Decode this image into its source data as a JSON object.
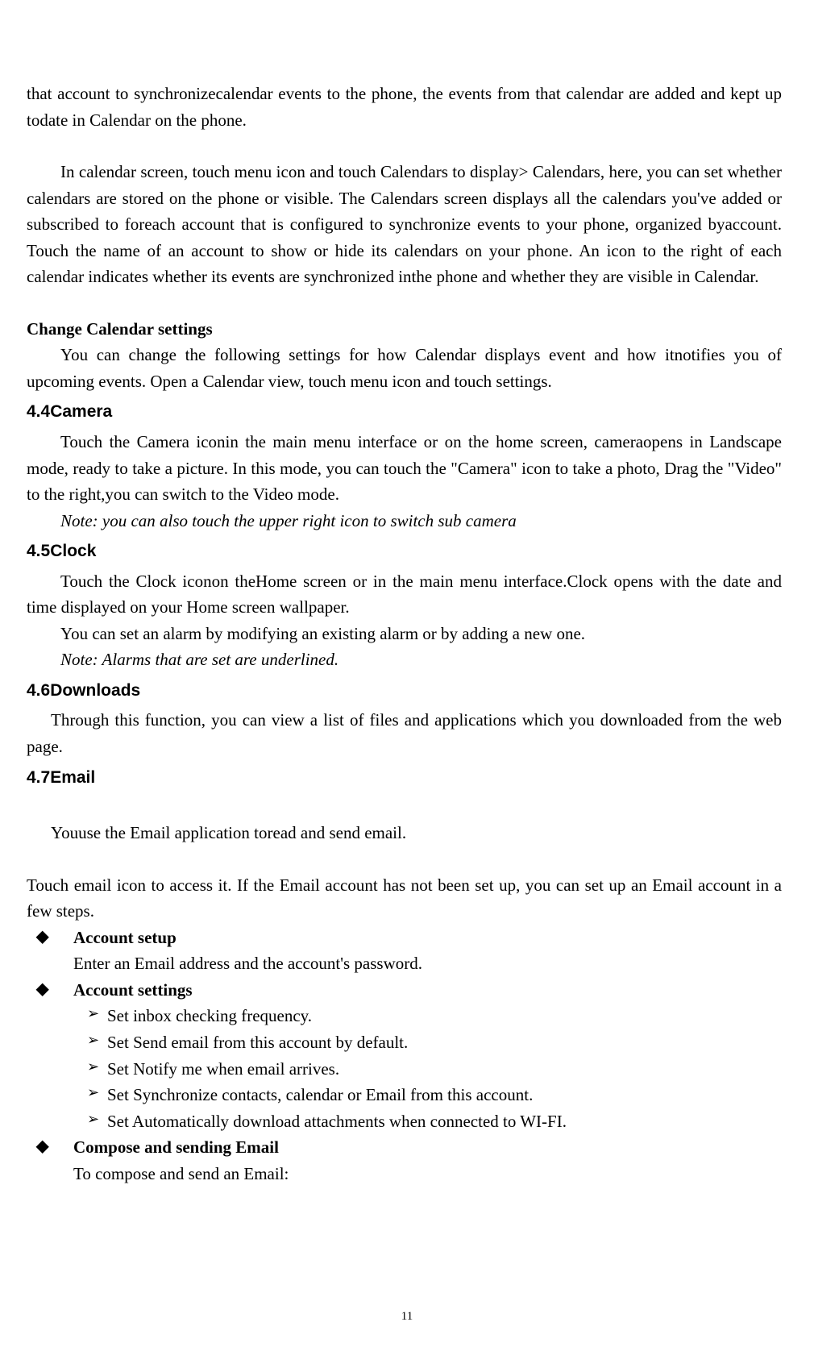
{
  "para1": "that account to synchronizecalendar events to the phone, the events from that calendar are added and kept up todate in Calendar on the phone.",
  "para2": "In calendar screen, touch menu icon and touch Calendars to display> Calendars, here, you can set whether calendars are stored on the phone or visible. The Calendars screen displays all the calendars you've added or subscribed to foreach account that is configured to synchronize events to your phone, organized byaccount. Touch the name of an account to show or hide its calendars on your phone. An icon to the right of each calendar indicates whether its events are synchronized inthe phone and whether they are visible in Calendar.",
  "h_change": "Change Calendar settings",
  "para3": "You can change the following settings for how Calendar displays event and how itnotifies you of upcoming events. Open a Calendar view, touch menu icon and touch settings.",
  "h44": "4.4Camera",
  "para4": "Touch the Camera iconin the main menu interface or on the home screen, cameraopens in Landscape mode, ready to take a picture. In this mode, you can touch the \"Camera\" icon to take a photo, Drag the \"Video\" to the right,you can switch to the Video mode.",
  "note1": "Note: you can also touch the upper right icon to switch sub camera",
  "h45": "4.5Clock",
  "para5": "Touch the Clock iconon theHome screen or in the main menu interface.Clock opens with the date and time displayed on your Home screen wallpaper.",
  "para5b": "You can set an alarm by modifying an existing alarm or by adding a new one.",
  "note2": "Note: Alarms that are set are underlined.",
  "h46": "4.6Downloads",
  "para6": "Through this function, you can view a list of files and applications which you downloaded from the web page.",
  "h47": "4.7Email",
  "para7": "Youuse the Email application toread and send email.",
  "para8": "Touch email icon to access it. If the Email account has not been set up, you can set up an Email account in a few steps.",
  "diamond1": "Account setup",
  "diamond1_sub": "Enter an Email address and the account's password.",
  "diamond2": "Account settings",
  "arrows": [
    "Set inbox checking frequency.",
    "Set Send email from this account by default.",
    "Set Notify me when email arrives.",
    "Set Synchronize contacts, calendar or Email from this account.",
    "Set Automatically download attachments when connected to WI-FI."
  ],
  "diamond3": "Compose and sending Email",
  "diamond3_sub": "To compose and send an Email:",
  "page_number": "11"
}
